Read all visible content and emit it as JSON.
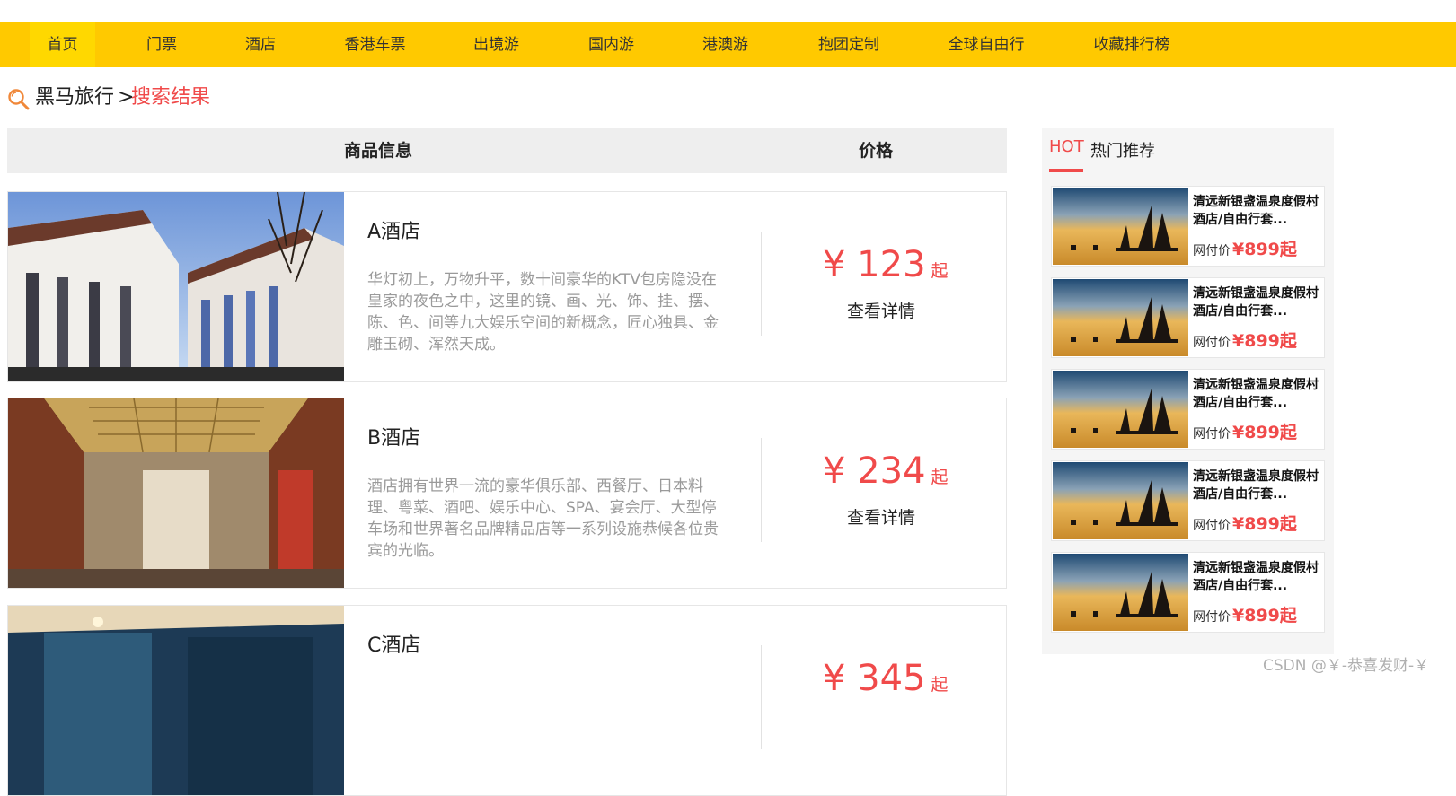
{
  "nav": {
    "items": [
      "首页",
      "门票",
      "酒店",
      "香港车票",
      "出境游",
      "国内游",
      "港澳游",
      "抱团定制",
      "全球自由行",
      "收藏排行榜"
    ]
  },
  "breadcrumb": {
    "home": "黑马旅行",
    "separator": ">",
    "current": "搜索结果"
  },
  "table_header": {
    "info": "商品信息",
    "price": "价格"
  },
  "results": [
    {
      "name": "A酒店",
      "desc": "华灯初上，万物升平，数十间豪华的KTV包房隐没在皇家的夜色之中，这里的镜、画、光、饰、挂、摆、陈、色、间等九大娱乐空间的新概念，匠心独具、金雕玉砌、浑然天成。",
      "price": "¥ 123",
      "price_suffix": "起",
      "detail": "查看详情"
    },
    {
      "name": "B酒店",
      "desc": "酒店拥有世界一流的豪华俱乐部、西餐厅、日本料理、粤菜、酒吧、娱乐中心、SPA、宴会厅、大型停车场和世界著名品牌精品店等一系列设施恭候各位贵宾的光临。",
      "price": "¥ 234",
      "price_suffix": "起",
      "detail": "查看详情"
    },
    {
      "name": "C酒店",
      "desc": "",
      "price": "¥ 345",
      "price_suffix": "起",
      "detail": ""
    }
  ],
  "sidebar": {
    "hot": "HOT",
    "title": "热门推荐",
    "items": [
      {
        "title": "清远新银盏温泉度假村酒店/自由行套...",
        "price_label": "网付价",
        "price": "¥899起"
      },
      {
        "title": "清远新银盏温泉度假村酒店/自由行套...",
        "price_label": "网付价",
        "price": "¥899起"
      },
      {
        "title": "清远新银盏温泉度假村酒店/自由行套...",
        "price_label": "网付价",
        "price": "¥899起"
      },
      {
        "title": "清远新银盏温泉度假村酒店/自由行套...",
        "price_label": "网付价",
        "price": "¥899起"
      },
      {
        "title": "清远新银盏温泉度假村酒店/自由行套...",
        "price_label": "网付价",
        "price": "¥899起"
      }
    ]
  },
  "watermark": "CSDN @￥-恭喜发财-￥",
  "colors": {
    "nav_bg": "#ffc900",
    "accent_red": "#f04a4a",
    "header_bg": "#eeeeee"
  }
}
